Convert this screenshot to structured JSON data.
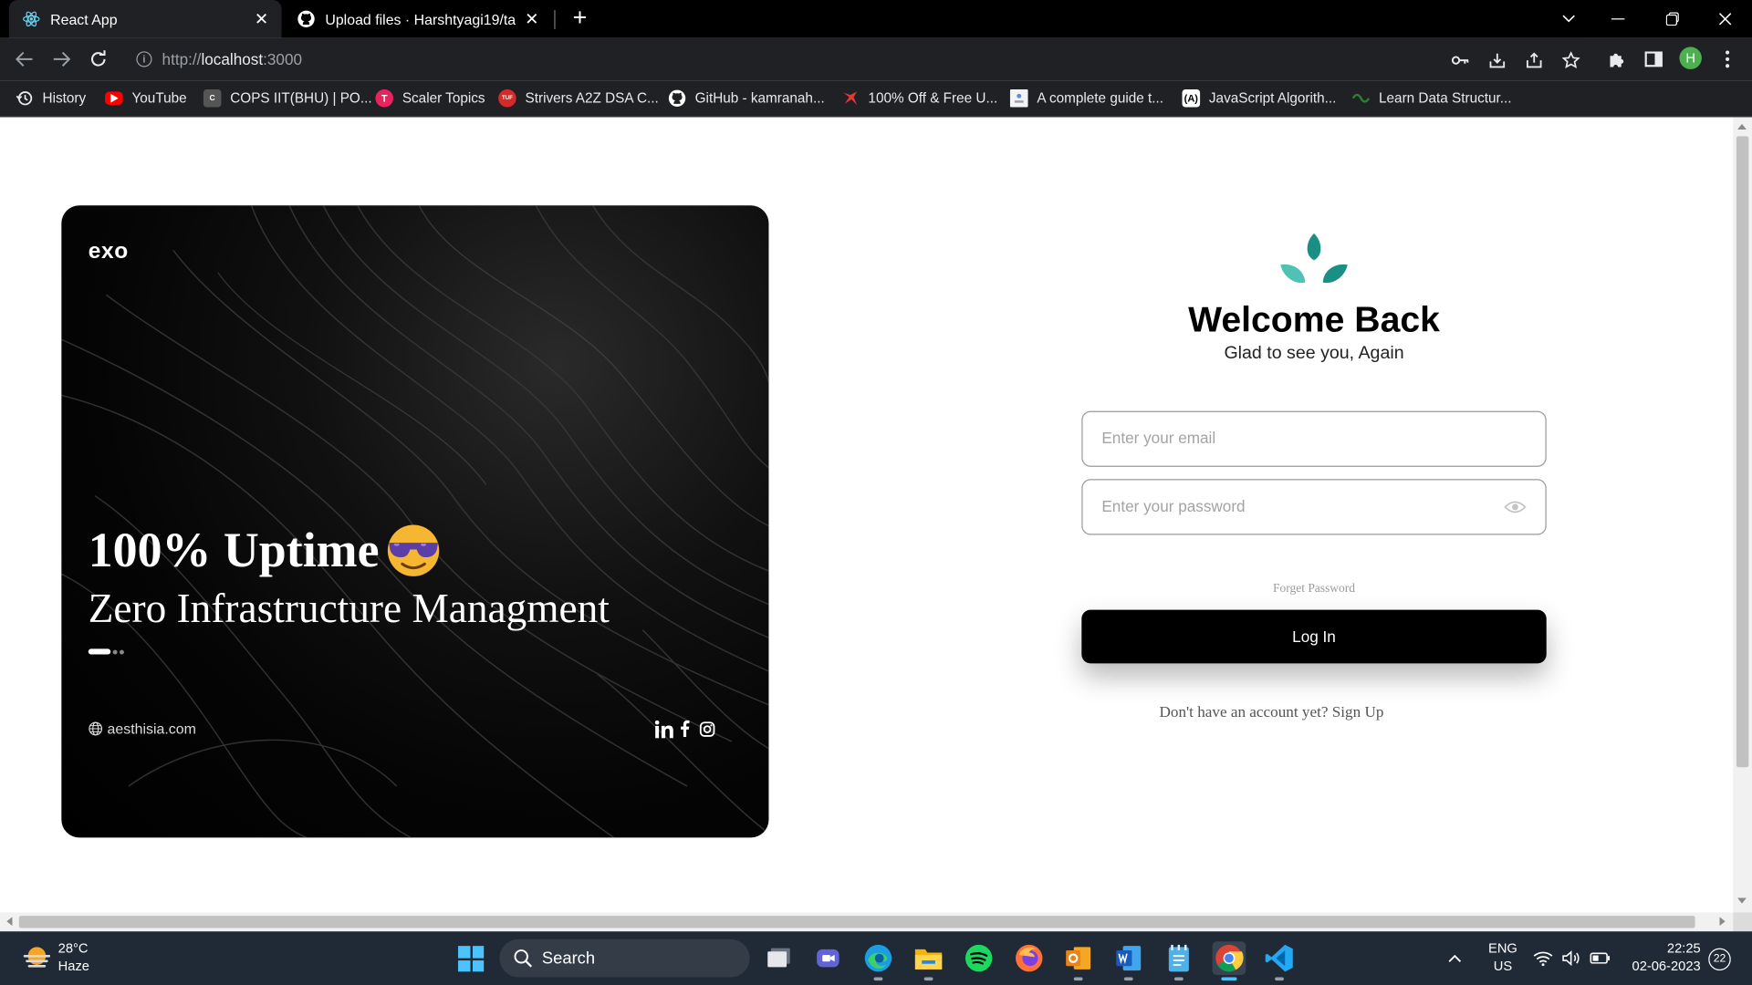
{
  "browser": {
    "tabs": [
      {
        "title": "React App",
        "active": true
      },
      {
        "title": "Upload files · Harshtyagi19/ta",
        "active": false
      }
    ],
    "address": {
      "scheme": "http://",
      "host": "localhost",
      "port": ":3000"
    },
    "profile_initial": "H"
  },
  "bookmarks": [
    {
      "label": "History",
      "icon": "history-icon"
    },
    {
      "label": "YouTube",
      "icon": "youtube-icon"
    },
    {
      "label": "COPS IIT(BHU) | PO...",
      "icon": "cops-icon"
    },
    {
      "label": "Scaler Topics",
      "icon": "scaler-icon"
    },
    {
      "label": "Strivers A2Z DSA C...",
      "icon": "tuf-icon"
    },
    {
      "label": "GitHub - kamranah...",
      "icon": "github-icon"
    },
    {
      "label": "100% Off & Free U...",
      "icon": "udemy-free-icon"
    },
    {
      "label": "A complete guide t...",
      "icon": "guide-icon"
    },
    {
      "label": "JavaScript Algorith...",
      "icon": "js-algo-icon"
    },
    {
      "label": "Learn Data Structur...",
      "icon": "ds-icon"
    }
  ],
  "hero": {
    "logo": "exo",
    "headline": "100% Uptime",
    "subline": "Zero Infrastructure Managment",
    "website": "aesthisia.com",
    "socials": [
      "linkedin-icon",
      "facebook-icon",
      "instagram-icon"
    ],
    "background": "#000000"
  },
  "login": {
    "title": "Welcome Back",
    "subtitle": "Glad to see you, Again",
    "email_placeholder": "Enter your email",
    "password_placeholder": "Enter your password",
    "forgot_label": "Forget Password",
    "login_label": "Log In",
    "signup_text": "Don't have an account yet? Sign Up",
    "accent": "#1fa79a"
  },
  "taskbar": {
    "weather": {
      "temp": "28°C",
      "desc": "Haze"
    },
    "search_label": "Search",
    "lang_top": "ENG",
    "lang_bottom": "US",
    "time": "22:25",
    "date": "02-06-2023",
    "notifications": "22"
  }
}
